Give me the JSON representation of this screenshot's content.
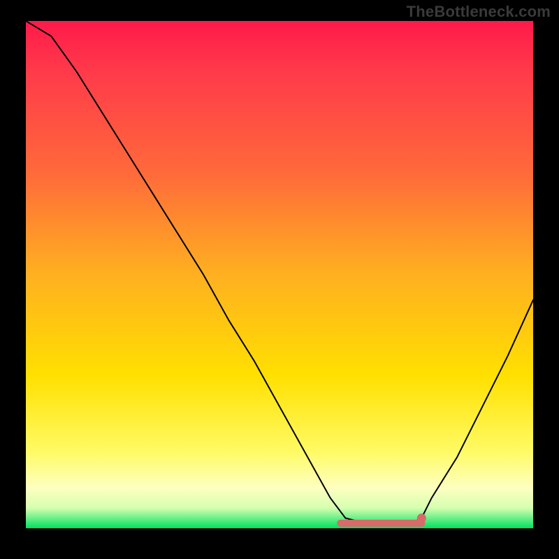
{
  "attribution": "TheBottleneck.com",
  "chart_data": {
    "type": "line",
    "title": "",
    "xlabel": "",
    "ylabel": "",
    "xlim": [
      0,
      100
    ],
    "ylim": [
      0,
      100
    ],
    "series": [
      {
        "name": "bottleneck-curve",
        "x": [
          0,
          5,
          10,
          15,
          20,
          25,
          30,
          35,
          40,
          45,
          50,
          55,
          60,
          63,
          67,
          72,
          76,
          78,
          80,
          85,
          90,
          95,
          100
        ],
        "values": [
          100,
          97,
          90,
          82,
          74,
          66,
          58,
          50,
          41,
          33,
          24,
          15,
          6,
          2,
          1,
          1,
          1,
          2,
          6,
          14,
          24,
          34,
          45
        ]
      }
    ],
    "optimal_band": {
      "x_start": 62,
      "x_end": 78,
      "y": 1
    },
    "optimal_marker": {
      "x": 78,
      "y": 2
    },
    "gradient_stops": [
      {
        "pos": 0,
        "color": "#ff1a4a"
      },
      {
        "pos": 10,
        "color": "#ff3a4a"
      },
      {
        "pos": 30,
        "color": "#ff6a3a"
      },
      {
        "pos": 50,
        "color": "#ffb020"
      },
      {
        "pos": 70,
        "color": "#ffe000"
      },
      {
        "pos": 85,
        "color": "#fffb66"
      },
      {
        "pos": 92,
        "color": "#fdffc0"
      },
      {
        "pos": 96,
        "color": "#d6ffb0"
      },
      {
        "pos": 100,
        "color": "#00e060"
      }
    ],
    "band_color": "#d76a6a",
    "curve_color": "#000000"
  }
}
